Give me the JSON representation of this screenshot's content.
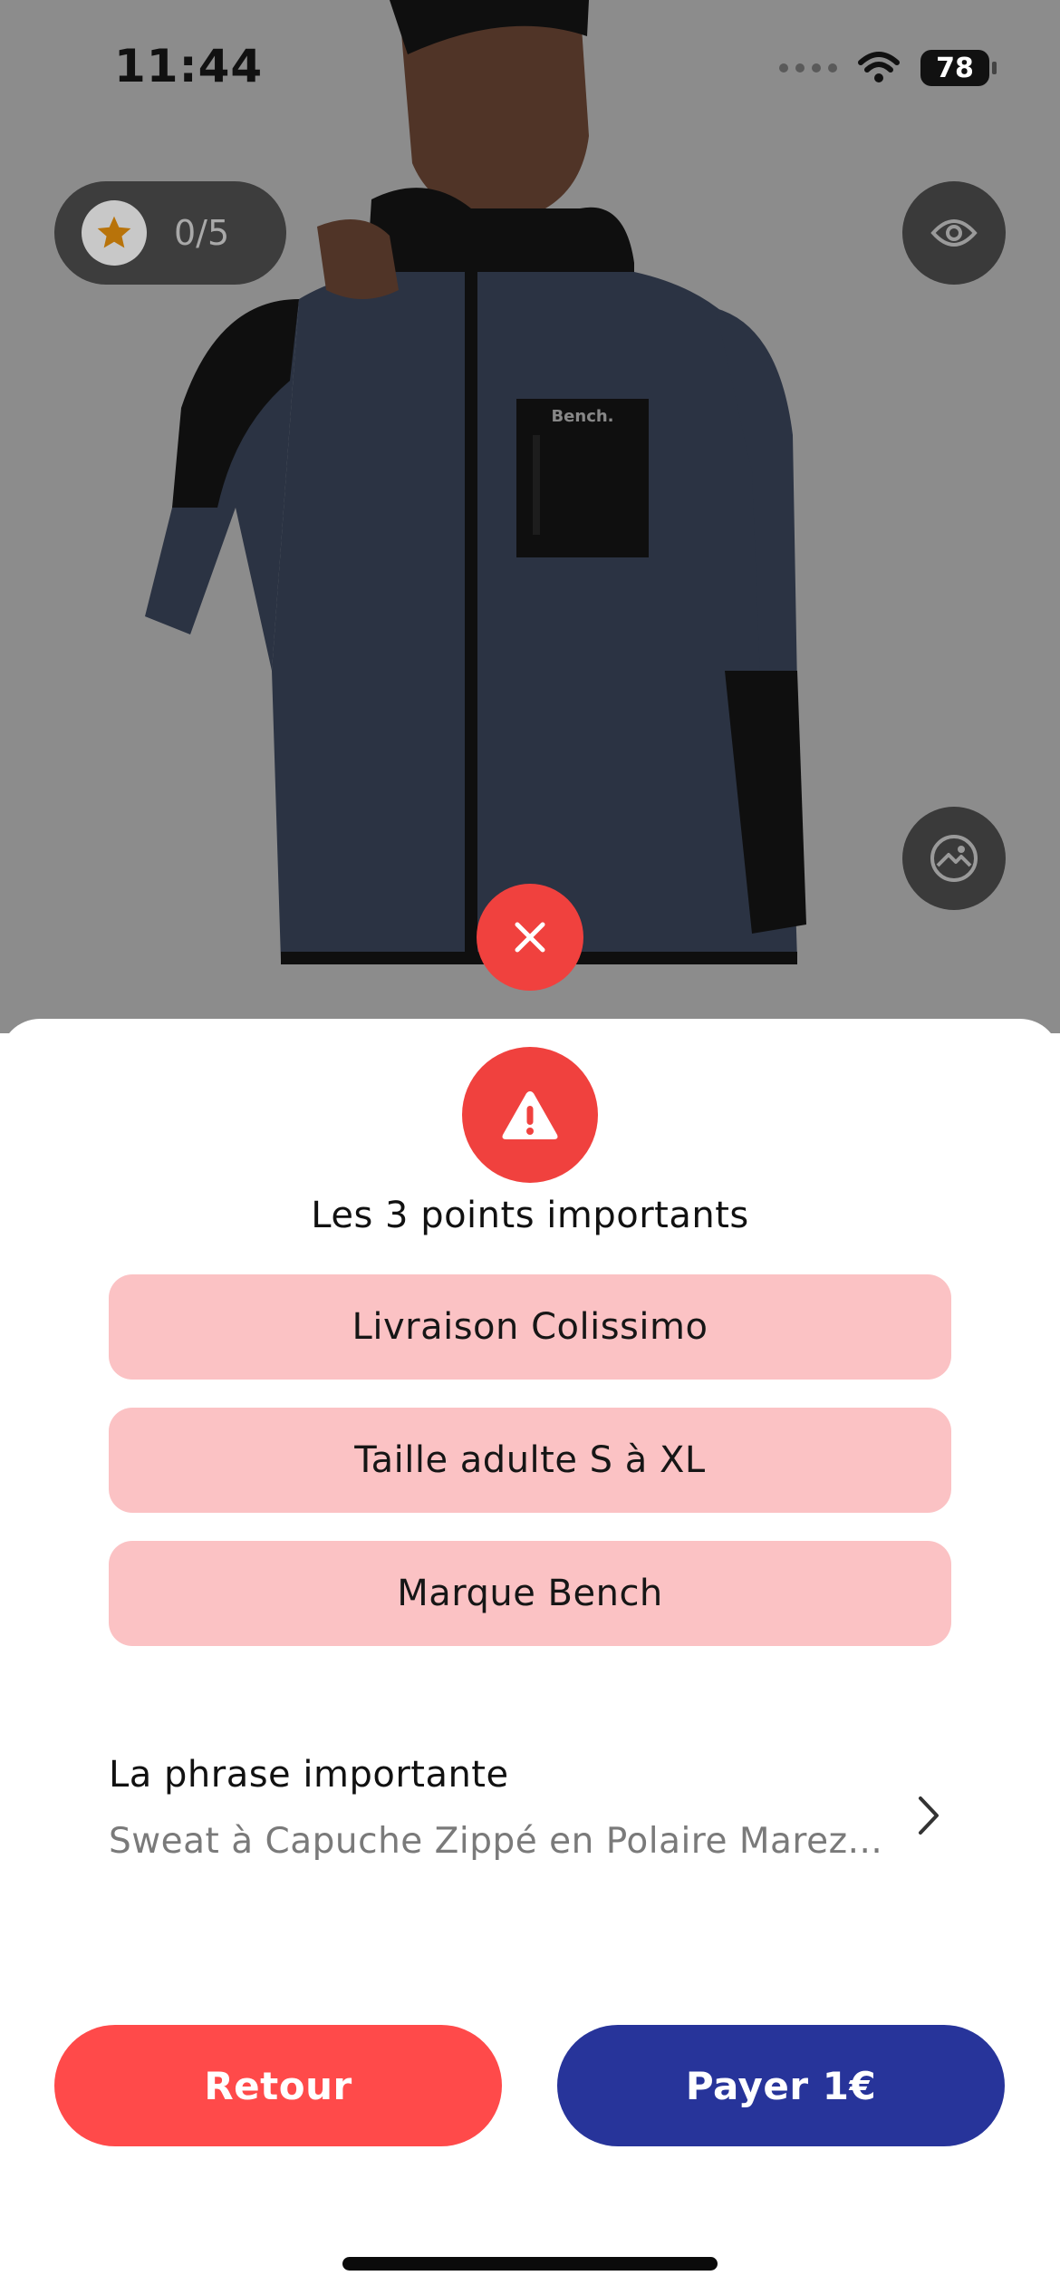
{
  "status_bar": {
    "time": "11:44",
    "battery": "78"
  },
  "product": {
    "image": "man-wearing-blue-sherpa-fleece-hooded-jacket",
    "brand_label": "Bench."
  },
  "rating": {
    "text": "0/5",
    "icon": "star-icon"
  },
  "sheet": {
    "title": "Les 3 points importants",
    "points": [
      {
        "label": "Livraison Colissimo"
      },
      {
        "label": "Taille adulte S à XL"
      },
      {
        "label": "Marque Bench"
      }
    ],
    "phrase": {
      "label": "La phrase importante",
      "value": "Sweat à Capuche Zippé en Polaire Marez..."
    }
  },
  "buttons": {
    "back_label": "Retour",
    "pay_label": "Payer 1€"
  },
  "colors": {
    "accent_red": "#f0413e",
    "button_red": "#ff4a4a",
    "button_blue": "#27349a",
    "point_bg": "#fbc2c4"
  }
}
